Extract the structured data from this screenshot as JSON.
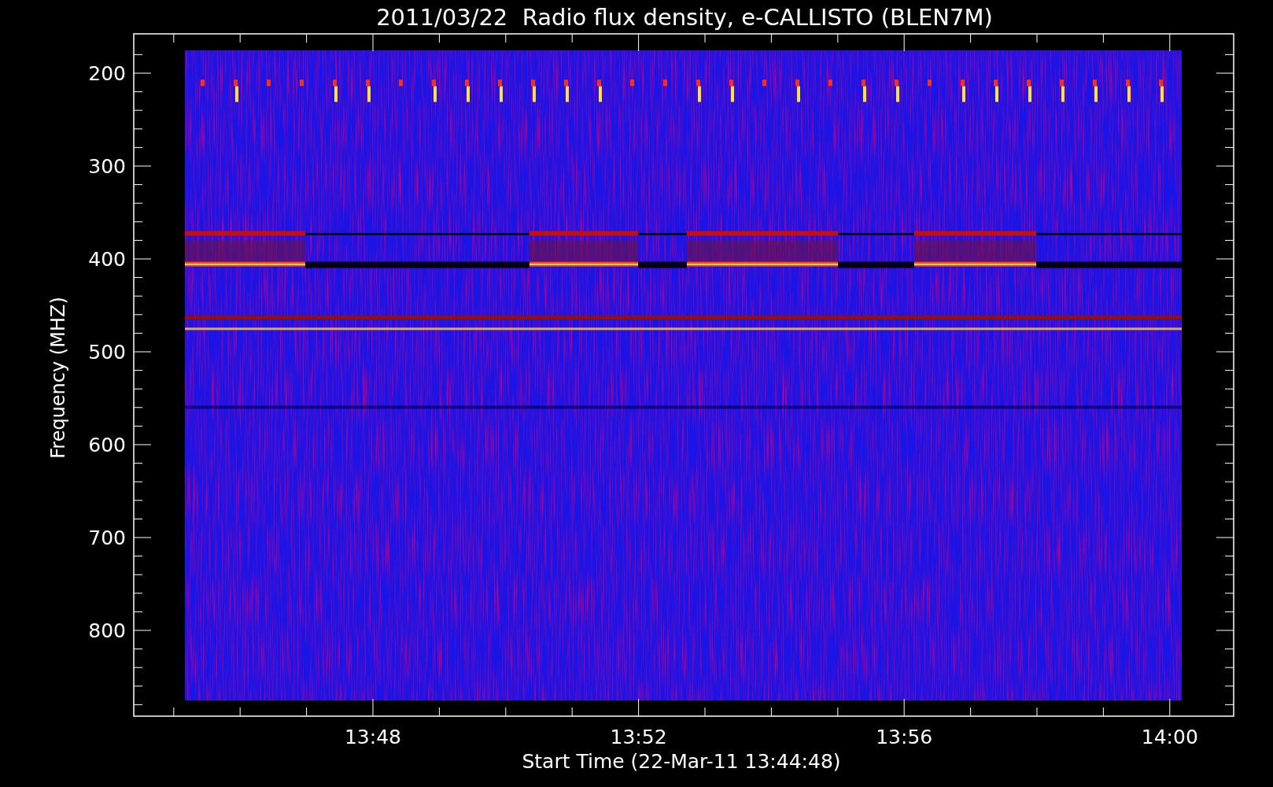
{
  "title": "2011/03/22  Radio flux density, e-CALLISTO (BLEN7M)",
  "ylabel": "Frequency (MHZ)",
  "xlabel": "Start Time (22-Mar-11 13:44:48)",
  "yticks": [
    "200",
    "300",
    "400",
    "500",
    "600",
    "700",
    "800"
  ],
  "xticks": [
    "13:48",
    "13:52",
    "13:56",
    "14:00"
  ]
}
